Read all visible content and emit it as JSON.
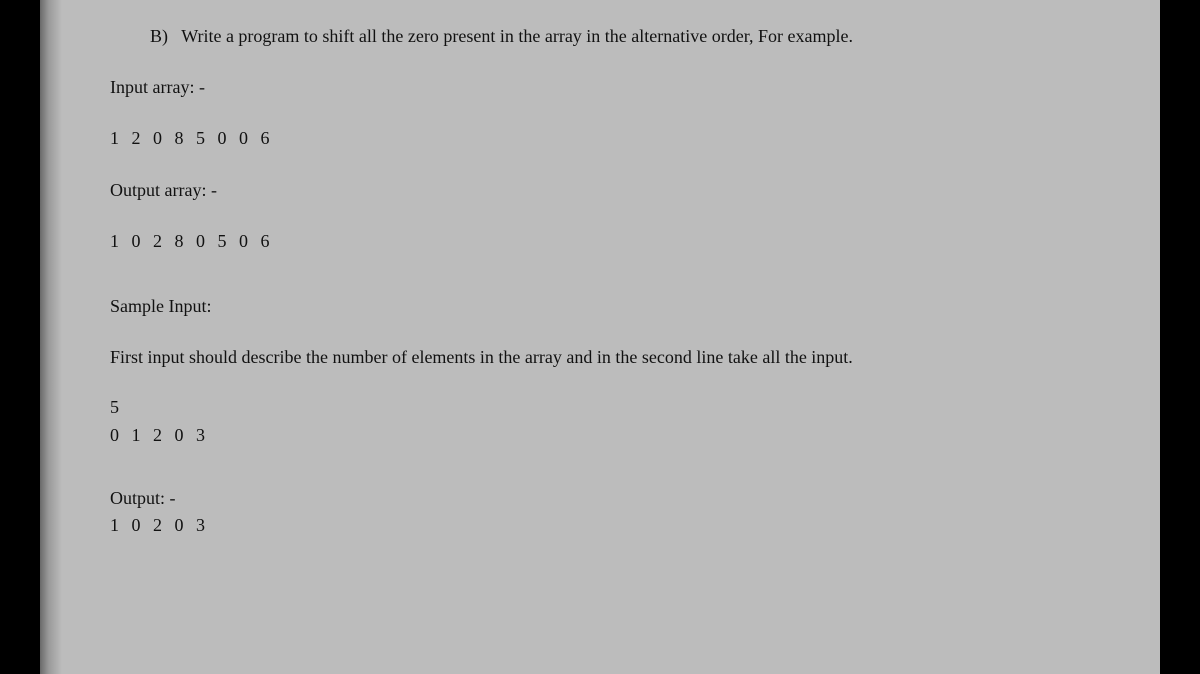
{
  "question": {
    "label": "B)",
    "prompt": "Write a program to shift all the zero present in the array in the alternative order, For example."
  },
  "example": {
    "input_label": "Input array: -",
    "input_values": "1 2 0 8 5 0 0 6",
    "output_label": "Output array: -",
    "output_values": "1 0 2 8 0 5 0 6"
  },
  "sample": {
    "heading": "Sample Input:",
    "description": "First input should describe the number of elements in the array and in the second line take all the input.",
    "n": "5",
    "input_values": "0 1 2 0 3",
    "output_label": "Output: -",
    "output_values": "1 0 2 0 3"
  }
}
